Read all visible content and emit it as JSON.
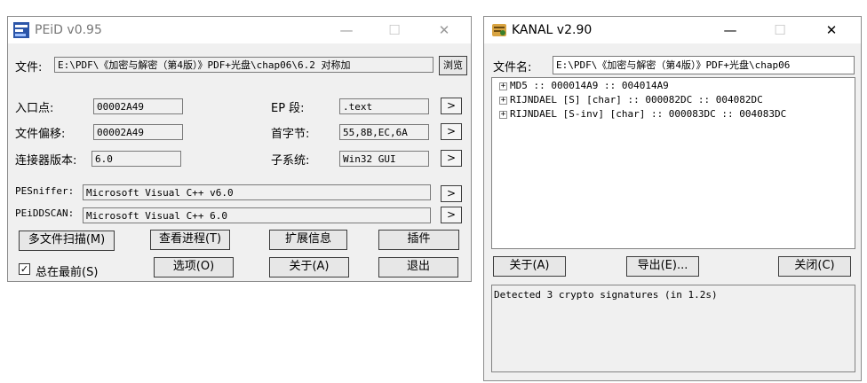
{
  "peid": {
    "title": "PEiD v0.95",
    "file_label": "文件:",
    "file_path": "E:\\PDF\\《加密与解密（第4版）》PDF+光盘\\chap06\\6.2 对称加",
    "browse_label": "浏览",
    "entry_label": "入口点:",
    "entry_value": "00002A49",
    "ep_section_label": "EP 段:",
    "ep_section_value": ".text",
    "file_offset_label": "文件偏移:",
    "file_offset_value": "00002A49",
    "first_bytes_label": "首字节:",
    "first_bytes_value": "55,8B,EC,6A",
    "linker_label": "连接器版本:",
    "linker_value": "6.0",
    "subsystem_label": "子系统:",
    "subsystem_value": "Win32 GUI",
    "pesniffer_label": "PESniffer:",
    "pesniffer_value": "Microsoft Visual C++ v6.0",
    "peidscan_label": "PEiDDSCAN:",
    "peidscan_value": "Microsoft Visual C++ 6.0",
    "arrow": ">",
    "btn_multi_scan": "多文件扫描(M)",
    "btn_process": "查看进程(T)",
    "btn_ext_info": "扩展信息",
    "btn_plugin": "插件",
    "always_on_top_label": "总在最前(S)",
    "always_on_top_checked": true,
    "btn_options": "选项(O)",
    "btn_about": "关于(A)",
    "btn_exit": "退出"
  },
  "kanal": {
    "title": "KANAL v2.90",
    "filename_label": "文件名:",
    "filename_value": "E:\\PDF\\《加密与解密（第4版）》PDF+光盘\\chap06",
    "tree": [
      {
        "text": "MD5 :: 000014A9 :: 004014A9"
      },
      {
        "text": "RIJNDAEL [S] [char] :: 000082DC :: 004082DC"
      },
      {
        "text": "RIJNDAEL [S-inv] [char] :: 000083DC :: 004083DC"
      }
    ],
    "btn_about": "关于(A)",
    "btn_export": "导出(E)...",
    "btn_close": "关闭(C)",
    "log_text": "Detected 3 crypto signatures  (in 1.2s)"
  },
  "window_controls": {
    "minimize": "—",
    "maximize": "☐",
    "close": "✕"
  },
  "colors": {
    "window_bg": "#f0f0f0",
    "titlebar_bg": "#ffffff",
    "accent": "#2b55a8"
  }
}
